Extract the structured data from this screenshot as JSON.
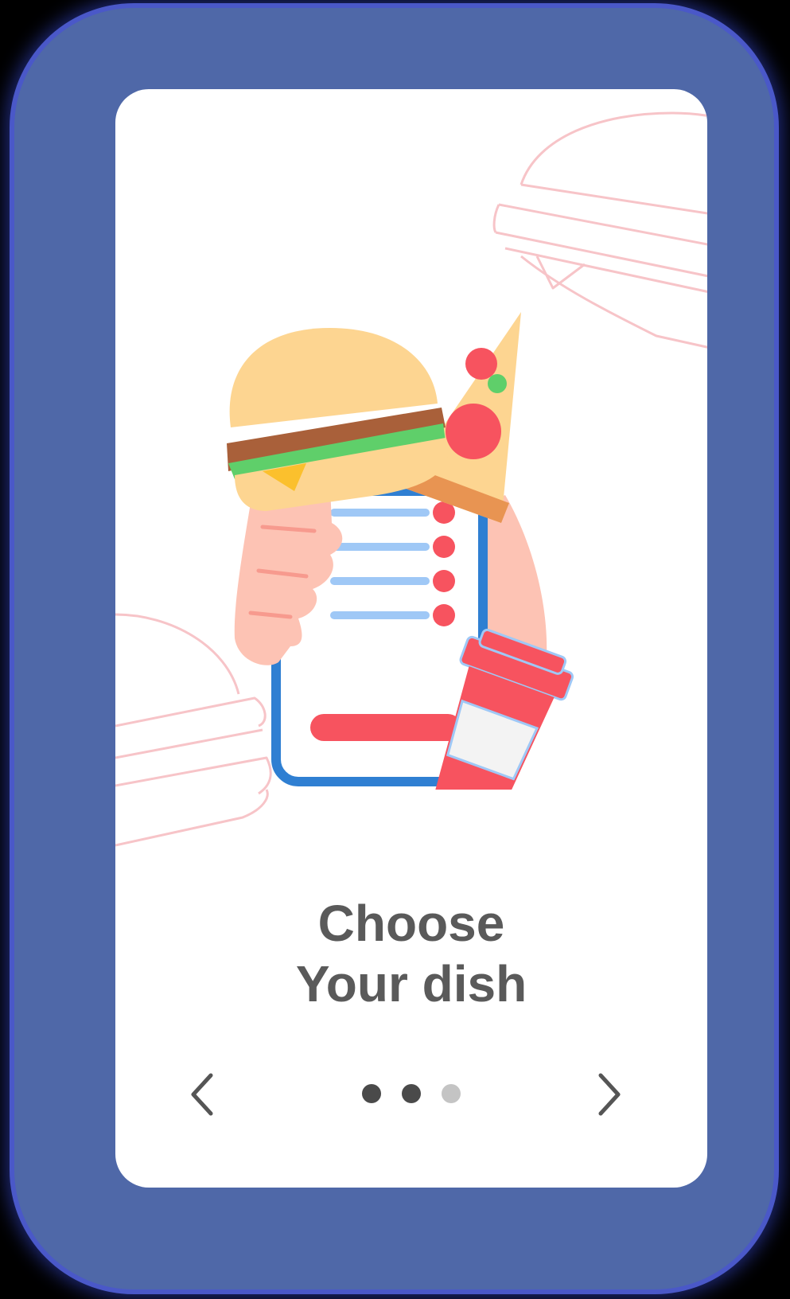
{
  "onboarding": {
    "title_line1": "Choose",
    "title_line2": "Your dish",
    "step": {
      "current": 2,
      "total": 3
    }
  },
  "colors": {
    "frame": "#4f68a8",
    "frame_glow": "#4a58c8",
    "screen": "#ffffff",
    "title": "#5a5a5a",
    "dot_active": "#4a4a4a",
    "dot_inactive": "#c4c4c4",
    "accent_red": "#f7535f",
    "phone_blue": "#2f7fd2",
    "skin": "#fdc3b4",
    "bun": "#fdd591",
    "patty": "#a9603a",
    "lettuce": "#5fcf6a",
    "list_blue": "#9fc8f6"
  },
  "icons": {
    "prev": "chevron-left-icon",
    "next": "chevron-right-icon"
  }
}
